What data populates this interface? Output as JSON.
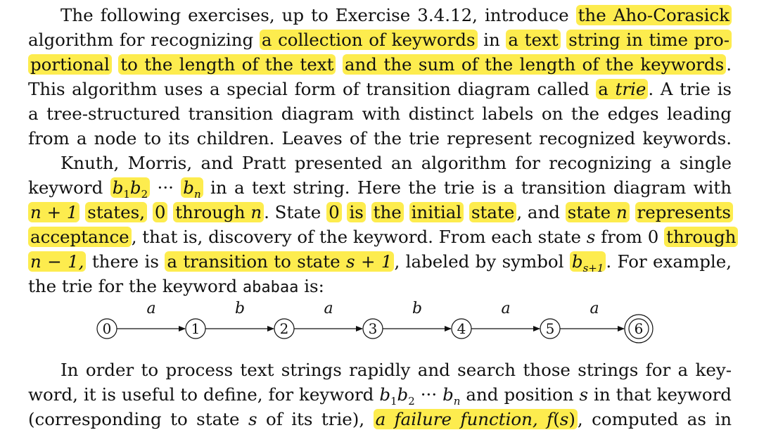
{
  "paragraphs": {
    "p1": {
      "l1": [
        "The following exercises, up to Exercise 3.4.12, introduce ",
        "the Aho-Corasick"
      ],
      "l2": [
        "algorithm for recognizing ",
        "a collection of keywords",
        " in ",
        "a text",
        " ",
        "string in time pro-"
      ],
      "l3": [
        "portional",
        " ",
        "to the length of the text",
        " ",
        "and the sum of the length of the keywords",
        "."
      ],
      "l4": [
        "This algorithm uses a special form of transition diagram called ",
        "a ",
        "trie",
        ". A trie is"
      ],
      "l5": "a tree-structured transition diagram with distinct labels on the edges leading",
      "l6": "from a node to its children. Leaves of the trie represent recognized keywords."
    },
    "p2": {
      "l1": "Knuth, Morris, and Pratt presented an algorithm for recognizing a single",
      "l2": [
        "keyword ",
        "b",
        "1",
        "b",
        "2",
        " ··· ",
        "b",
        "n",
        " in a text string. Here the trie is a transition diagram with"
      ],
      "l3": [
        "n + 1",
        " ",
        "states,",
        " ",
        "0",
        " ",
        "through ",
        "n",
        ". State ",
        "0",
        " ",
        "is",
        " ",
        "the",
        " ",
        "initial",
        " ",
        "state",
        ", and ",
        "state ",
        "n",
        " ",
        "represents"
      ],
      "l4": [
        "acceptance",
        ", that is, discovery of the keyword. From each state ",
        "s",
        " from 0 ",
        "through"
      ],
      "l5": [
        "n − 1,",
        " there is ",
        "a transition to state ",
        "s + 1",
        ", labeled by symbol ",
        "b",
        "s+1",
        ". For example,"
      ],
      "l6": [
        "the trie for the keyword ",
        "ababaa",
        " is:"
      ]
    },
    "p3": {
      "l1": "In order to process text strings rapidly and search those strings for a key-",
      "l2": [
        "word, it is useful to define, for keyword ",
        "b",
        "1",
        "b",
        "2",
        " ··· ",
        "b",
        "n",
        " and position ",
        "s",
        " in that keyword"
      ],
      "l3": [
        "(corresponding to state ",
        "s",
        " of its trie), ",
        "a failure function, f",
        "(",
        "s",
        ")",
        ", computed as in"
      ]
    }
  },
  "diagram": {
    "states": [
      "0",
      "1",
      "2",
      "3",
      "4",
      "5",
      "6"
    ],
    "edge_labels": [
      "a",
      "b",
      "a",
      "b",
      "a",
      "a"
    ],
    "accepting_state": "6"
  },
  "colors": {
    "highlight": "#fdec4e",
    "text": "#111111"
  }
}
